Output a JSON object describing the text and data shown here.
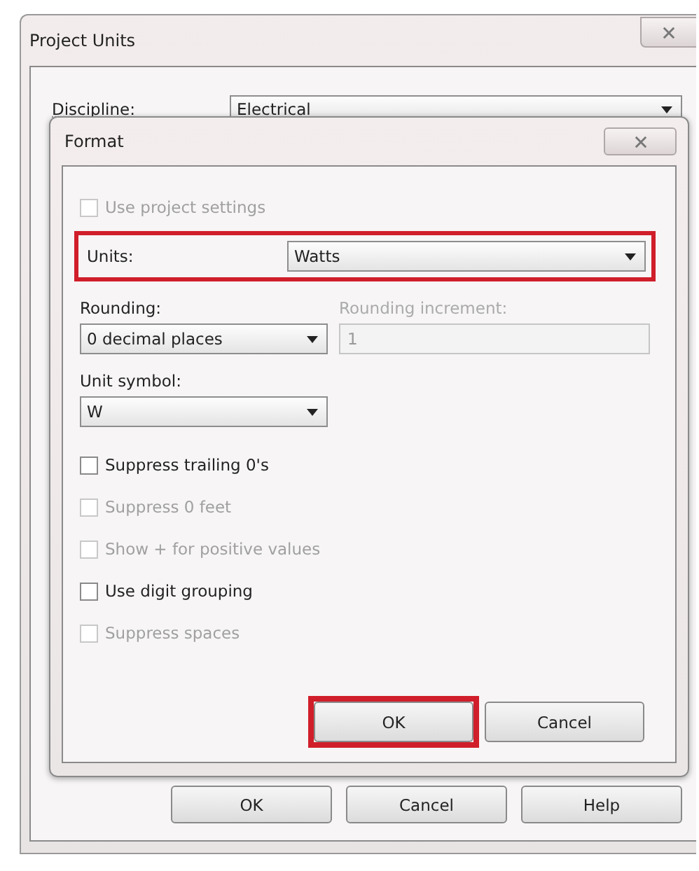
{
  "window": {
    "title": "Project Units"
  },
  "discipline": {
    "label": "Discipline:",
    "value": "Electrical"
  },
  "format_dialog": {
    "title": "Format",
    "use_project_settings": {
      "label": "Use project settings",
      "checked": false,
      "disabled": true
    },
    "units": {
      "label": "Units:",
      "value": "Watts",
      "highlighted": true
    },
    "rounding": {
      "label": "Rounding:",
      "value": "0 decimal places"
    },
    "rounding_increment": {
      "label": "Rounding increment:",
      "value": "1",
      "disabled": true
    },
    "unit_symbol": {
      "label": "Unit symbol:",
      "value": "W"
    },
    "options": [
      {
        "label": "Suppress trailing 0's",
        "checked": false,
        "disabled": false
      },
      {
        "label": "Suppress 0 feet",
        "checked": false,
        "disabled": true
      },
      {
        "label": "Show + for positive values",
        "checked": false,
        "disabled": true
      },
      {
        "label": "Use digit grouping",
        "checked": false,
        "disabled": false
      },
      {
        "label": "Suppress spaces",
        "checked": false,
        "disabled": true
      }
    ],
    "buttons": [
      {
        "label": "OK",
        "highlighted": true
      },
      {
        "label": "Cancel",
        "highlighted": false
      }
    ]
  },
  "buttons": [
    {
      "label": "OK"
    },
    {
      "label": "Cancel"
    },
    {
      "label": "Help"
    }
  ]
}
